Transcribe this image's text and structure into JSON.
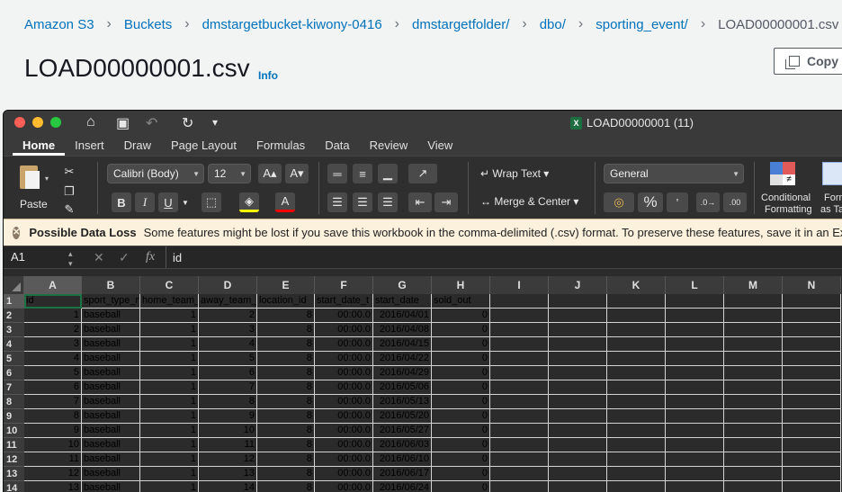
{
  "breadcrumb": [
    "Amazon S3",
    "Buckets",
    "dmstargetbucket-kiwony-0416",
    "dmstargetfolder/",
    "dbo/",
    "sporting_event/",
    "LOAD00000001.csv"
  ],
  "page": {
    "title": "LOAD00000001.csv",
    "info_label": "Info",
    "copy_label": "Copy"
  },
  "excel": {
    "window_title": "LOAD00000001 (11)",
    "tabs": [
      "Home",
      "Insert",
      "Draw",
      "Page Layout",
      "Formulas",
      "Data",
      "Review",
      "View"
    ],
    "active_tab": "Home",
    "ribbon": {
      "paste": "Paste",
      "font_name": "Calibri (Body)",
      "font_size": "12",
      "bold": "B",
      "italic": "I",
      "underline": "U",
      "wrap_text": "Wrap Text",
      "merge_center": "Merge & Center",
      "number_format": "General",
      "percent": "%",
      "conditional_1": "Conditional",
      "conditional_2": "Formatting",
      "format_table_1": "Form",
      "format_table_2": "as Ta"
    },
    "warning": {
      "title": "Possible Data Loss",
      "message": "Some features might be lost if you save this workbook in the comma-delimited (.csv) format. To preserve these features, save it in an Excel"
    },
    "formula_bar": {
      "cell_ref": "A1",
      "fx": "fx",
      "value": "id"
    },
    "columns": [
      "A",
      "B",
      "C",
      "D",
      "E",
      "F",
      "G",
      "H",
      "I",
      "J",
      "K",
      "L",
      "M",
      "N"
    ],
    "headers": [
      "id",
      "sport_type_n",
      "home_team_",
      "away_team_",
      "location_id",
      "start_date_t",
      "start_date",
      "sold_out"
    ],
    "rows": [
      [
        "1",
        "baseball",
        "1",
        "2",
        "8",
        "00:00.0",
        "2016/04/01",
        "0"
      ],
      [
        "2",
        "baseball",
        "1",
        "3",
        "8",
        "00:00.0",
        "2016/04/08",
        "0"
      ],
      [
        "3",
        "baseball",
        "1",
        "4",
        "8",
        "00:00.0",
        "2016/04/15",
        "0"
      ],
      [
        "4",
        "baseball",
        "1",
        "5",
        "8",
        "00:00.0",
        "2016/04/22",
        "0"
      ],
      [
        "5",
        "baseball",
        "1",
        "6",
        "8",
        "00:00.0",
        "2016/04/29",
        "0"
      ],
      [
        "6",
        "baseball",
        "1",
        "7",
        "8",
        "00:00.0",
        "2016/05/06",
        "0"
      ],
      [
        "7",
        "baseball",
        "1",
        "8",
        "8",
        "00:00.0",
        "2016/05/13",
        "0"
      ],
      [
        "8",
        "baseball",
        "1",
        "9",
        "8",
        "00:00.0",
        "2016/05/20",
        "0"
      ],
      [
        "9",
        "baseball",
        "1",
        "10",
        "8",
        "00:00.0",
        "2016/05/27",
        "0"
      ],
      [
        "10",
        "baseball",
        "1",
        "11",
        "8",
        "00:00.0",
        "2016/06/03",
        "0"
      ],
      [
        "11",
        "baseball",
        "1",
        "12",
        "8",
        "00:00.0",
        "2016/06/10",
        "0"
      ],
      [
        "12",
        "baseball",
        "1",
        "13",
        "8",
        "00:00.0",
        "2016/06/17",
        "0"
      ],
      [
        "13",
        "baseball",
        "1",
        "14",
        "8",
        "00:00.0",
        "2016/06/24",
        "0"
      ]
    ]
  }
}
